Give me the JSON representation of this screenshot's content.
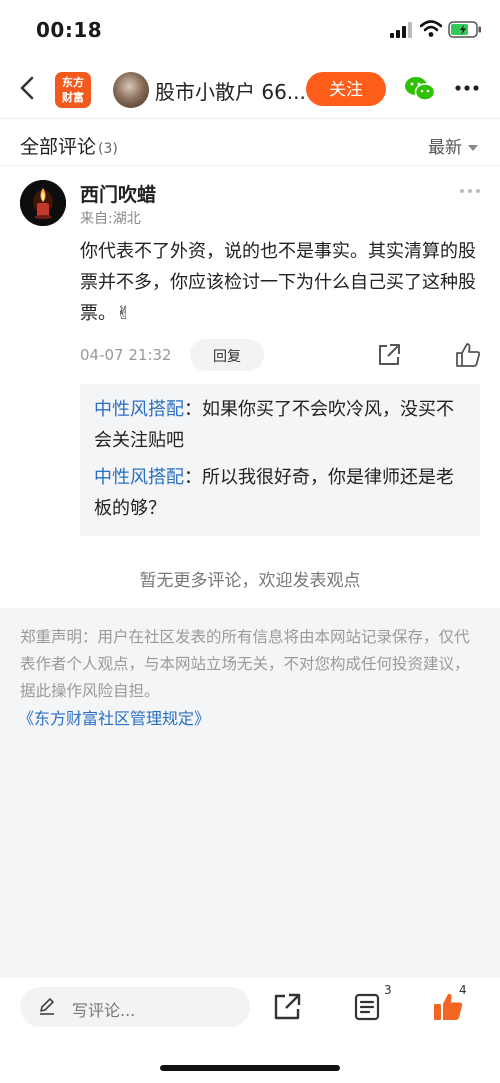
{
  "status_bar": {
    "time": "00:18"
  },
  "header": {
    "logo_line1": "东方",
    "logo_line2": "财富",
    "author_name": "股市小散户 66...",
    "follow_label": "关注"
  },
  "section": {
    "title": "全部评论",
    "count": "(3)",
    "sort_label": "最新"
  },
  "comment": {
    "username": "西门吹蜡",
    "location": "来自:湖北",
    "text": "你代表不了外资，说的也不是事实。其实清算的股票并不多，你应该检讨一下为什么自己买了这种股票。✌",
    "time": "04-07 21:32",
    "reply_label": "回复",
    "replies": [
      {
        "name": "中性风搭配",
        "text": "：如果你买了不会吹冷风，没买不会关注贴吧"
      },
      {
        "name": "中性风搭配",
        "text": "：所以我很好奇，你是律师还是老板的够？"
      }
    ]
  },
  "no_more": "暂无更多评论，欢迎发表观点",
  "disclaimer": {
    "text": "郑重声明：用户在社区发表的所有信息将由本网站记录保存，仅代表作者个人观点，与本网站立场无关，不对您构成任何投资建议，据此操作风险自担。",
    "link": "《东方财富社区管理规定》"
  },
  "bottom_bar": {
    "comment_placeholder": "写评论...",
    "comment_count": "3",
    "like_count": "4"
  },
  "colors": {
    "accent": "#ff5e1a",
    "link": "#2a6fc4",
    "like": "#f26522"
  }
}
